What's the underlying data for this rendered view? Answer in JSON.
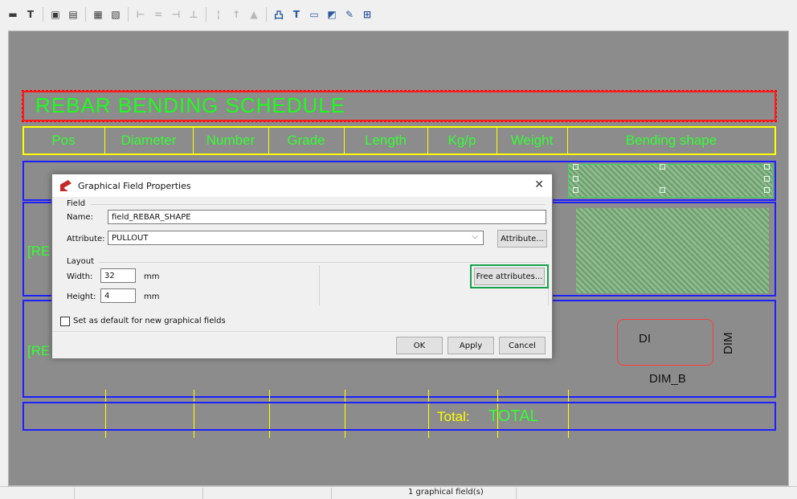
{
  "toolbar": {
    "buttons": [
      {
        "glyph": "▬",
        "name": "insert-field-icon"
      },
      {
        "glyph": "T",
        "name": "insert-text-icon"
      },
      {
        "glyph": "▣",
        "name": "insert-picture-icon"
      },
      {
        "glyph": "▤",
        "name": "insert-graphic-icon"
      },
      {
        "glyph": "▦",
        "name": "insert-symbol-icon"
      },
      {
        "glyph": "▧",
        "name": "erase-icon"
      },
      {
        "glyph": "⊢",
        "name": "align-left-icon"
      },
      {
        "glyph": "=",
        "name": "align-center-icon"
      },
      {
        "glyph": "⊣",
        "name": "align-right-icon"
      },
      {
        "glyph": "⊥",
        "name": "align-bottom-icon"
      },
      {
        "glyph": "¦",
        "name": "distribute-icon"
      },
      {
        "glyph": "↑",
        "name": "align-top-icon"
      },
      {
        "glyph": "▲",
        "name": "align-middle-icon"
      },
      {
        "glyph": "凸",
        "name": "dimension-icon"
      },
      {
        "glyph": "T",
        "name": "text-tool-icon"
      },
      {
        "glyph": "▭",
        "name": "rectangle-tool-icon"
      },
      {
        "glyph": "◩",
        "name": "frame-tool-icon"
      },
      {
        "glyph": "✎",
        "name": "line-tool-icon"
      },
      {
        "glyph": "⊞",
        "name": "grid-tool-icon"
      }
    ]
  },
  "report": {
    "title": "REBAR BENDING SCHEDULE",
    "headers": [
      "Pos",
      "Diameter",
      "Number",
      "Grade",
      "Length",
      "Kg/p",
      "Weight",
      "Bending shape"
    ],
    "row_partials": {
      "row2_left": "[RE",
      "row3_left": "[RE"
    },
    "shape_dim_inside": "DI",
    "shape_dim_vertical": "DIM",
    "shape_dim_bottom": "DIM_B",
    "total_label": "Total:",
    "total_field": "TOTAL"
  },
  "dialog": {
    "title": "Graphical Field Properties",
    "close_glyph": "✕",
    "group_field": "Field",
    "name_label": "Name:",
    "name_value": "field_REBAR_SHAPE",
    "attribute_label": "Attribute:",
    "attribute_value": "PULLOUT",
    "attribute_button": "Attribute...",
    "group_layout": "Layout",
    "width_label": "Width:",
    "width_value": "32",
    "width_unit": "mm",
    "height_label": "Height:",
    "height_value": "4",
    "height_unit": "mm",
    "free_attributes_button": "Free attributes...",
    "default_checkbox_label": "Set as default for new graphical fields",
    "ok_button": "OK",
    "apply_button": "Apply",
    "cancel_button": "Cancel"
  },
  "status": {
    "text": "1 graphical field(s)"
  },
  "colors": {
    "canvas": "#8c8c8c",
    "title_border": "#ff1a1a",
    "field_text": "#33ff33",
    "header_border": "#ffff00",
    "row_border": "#1f1fff",
    "highlight": "#16a34a"
  }
}
